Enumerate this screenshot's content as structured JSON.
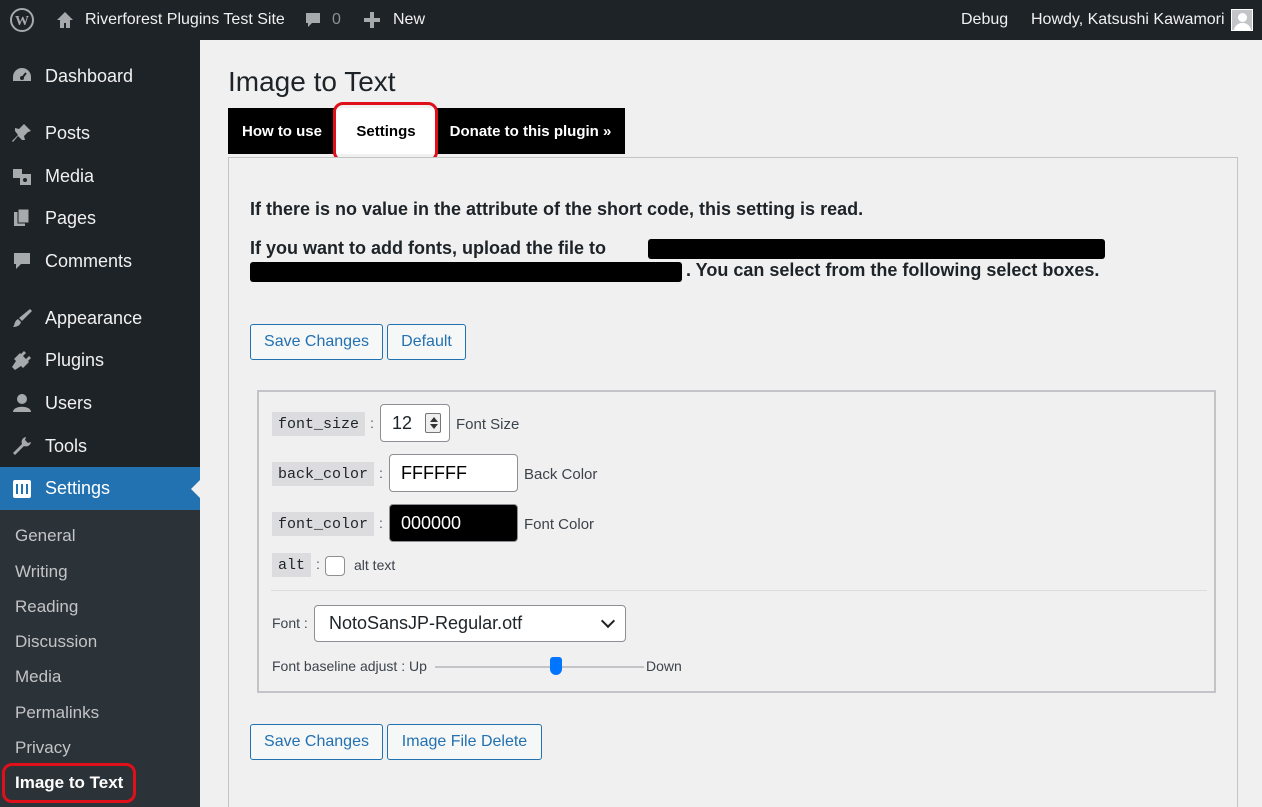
{
  "admin_bar": {
    "site_name": "Riverforest Plugins Test Site",
    "comments_count": "0",
    "new_label": "New",
    "debug_label": "Debug",
    "greeting": "Howdy, Katsushi Kawamori"
  },
  "menu": {
    "items": [
      {
        "label": "Dashboard",
        "icon": "dashboard-icon"
      },
      {
        "label": "Posts",
        "icon": "pin-icon"
      },
      {
        "label": "Media",
        "icon": "media-icon"
      },
      {
        "label": "Pages",
        "icon": "pages-icon"
      },
      {
        "label": "Comments",
        "icon": "comment-icon"
      },
      {
        "label": "Appearance",
        "icon": "brush-icon"
      },
      {
        "label": "Plugins",
        "icon": "plug-icon"
      },
      {
        "label": "Users",
        "icon": "user-icon"
      },
      {
        "label": "Tools",
        "icon": "wrench-icon"
      },
      {
        "label": "Settings",
        "icon": "settings-icon"
      }
    ],
    "submenu": [
      "General",
      "Writing",
      "Reading",
      "Discussion",
      "Media",
      "Permalinks",
      "Privacy",
      "Image to Text"
    ]
  },
  "page": {
    "title": "Image to Text",
    "tabs": [
      "How to use",
      "Settings",
      "Donate to this plugin »"
    ],
    "notice1": "If there is no value in the attribute of the short code, this setting is read.",
    "notice2": "If you want to add fonts, upload the file to",
    "notice3": ". You can select from the following select boxes.",
    "buttons_top": [
      "Save Changes",
      "Default"
    ],
    "buttons_bottom": [
      "Save Changes",
      "Image File Delete"
    ]
  },
  "settings": {
    "font_size": {
      "key": "font_size",
      "value": "12",
      "label": "Font Size"
    },
    "back_color": {
      "key": "back_color",
      "value": "FFFFFF",
      "label": "Back Color",
      "bg": "#ffffff",
      "fg": "#000000"
    },
    "font_color": {
      "key": "font_color",
      "value": "000000",
      "label": "Font Color",
      "bg": "#000000",
      "fg": "#ffffff"
    },
    "alt": {
      "key": "alt",
      "label": "alt text",
      "checked": false
    },
    "font": {
      "label": "Font :",
      "value": "NotoSansJP-Regular.otf"
    },
    "baseline": {
      "label_left": "Font baseline adjust : Up",
      "label_right": "Down",
      "value_fraction": 0.58
    }
  },
  "colors": {
    "admin_bar": "#1d2327",
    "accent": "#2271b1",
    "highlight_ring": "#e0101a"
  }
}
